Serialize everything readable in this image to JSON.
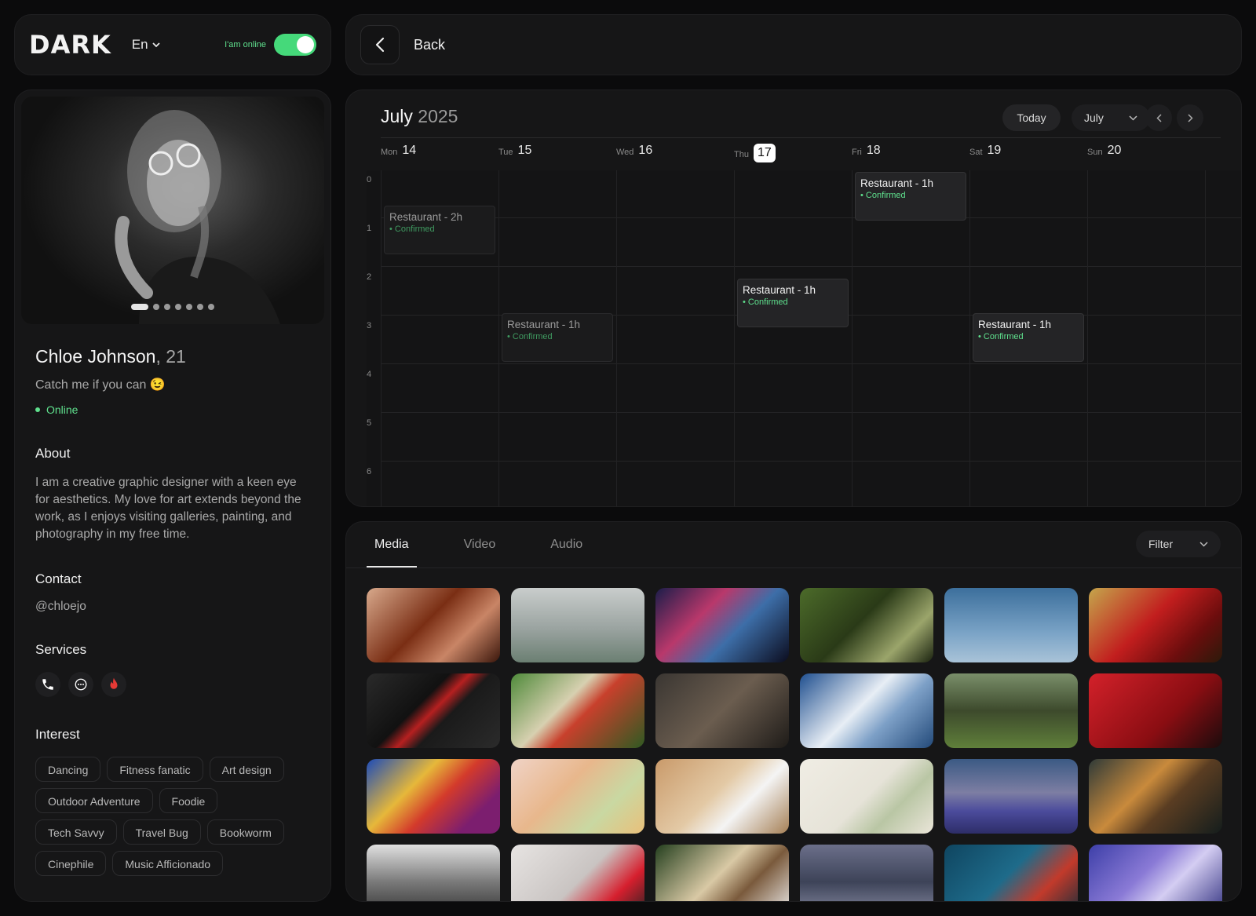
{
  "header": {
    "logo": "DARK",
    "language": "En",
    "online_label": "I'am online",
    "back_label": "Back"
  },
  "profile": {
    "carousel": {
      "count": 7,
      "active": 0
    },
    "name": "Chloe Johnson",
    "age": ", 21",
    "tagline": "Catch me if you can 😉",
    "status": "Online",
    "about_title": "About",
    "about_text": "I am a creative graphic designer with a keen eye for aesthetics. My love for art extends beyond the work, as I enjoys visiting galleries, painting, and photography in my free time.",
    "contact_title": "Contact",
    "contact": "@chloejo",
    "services_title": "Services",
    "services": [
      "phone-icon",
      "chat-icon",
      "flame-icon"
    ],
    "interest_title": "Interest",
    "interests": [
      "Dancing",
      "Fitness fanatic",
      "Art design",
      "Outdoor Adventure",
      "Foodie",
      "Tech Savvy",
      "Travel Bug",
      "Bookworm",
      "Cinephile",
      "Music Afficionado"
    ]
  },
  "calendar": {
    "month": "July",
    "year": "2025",
    "today_label": "Today",
    "month_select": "July",
    "days": [
      {
        "name": "Mon",
        "date": "14"
      },
      {
        "name": "Tue",
        "date": "15"
      },
      {
        "name": "Wed",
        "date": "16"
      },
      {
        "name": "Thu",
        "date": "17",
        "today": true
      },
      {
        "name": "Fri",
        "date": "18"
      },
      {
        "name": "Sat",
        "date": "19"
      },
      {
        "name": "Sun",
        "date": "20"
      }
    ],
    "hours": [
      "0",
      "1",
      "2",
      "3",
      "4",
      "5",
      "6"
    ],
    "events": [
      {
        "title": "Restaurant - 2h",
        "status": "Confirmed",
        "day": 0,
        "hour": 0.7,
        "faded": true
      },
      {
        "title": "Restaurant - 1h",
        "status": "Confirmed",
        "day": 1,
        "hour": 2.9,
        "faded": true
      },
      {
        "title": "Restaurant - 1h",
        "status": "Confirmed",
        "day": 3,
        "hour": 2.2,
        "faded": false
      },
      {
        "title": "Restaurant - 1h",
        "status": "Confirmed",
        "day": 4,
        "hour": 0.0,
        "faded": false
      },
      {
        "title": "Restaurant - 1h",
        "status": "Confirmed",
        "day": 5,
        "hour": 2.9,
        "faded": false
      }
    ]
  },
  "media": {
    "tabs": [
      "Media",
      "Video",
      "Audio"
    ],
    "active_tab": 0,
    "filter_label": "Filter",
    "thumbs": [
      "linear-gradient(135deg,#d8a98c,#7a2e14 45%,#c98566 70%,#3a160b)",
      "linear-gradient(180deg,#c9cdcc,#9aa3a0 55%,#6b7f72)",
      "linear-gradient(135deg,#1b1d4a,#b9386b 35%,#3d6ea8 60%,#0b0c1e)",
      "linear-gradient(135deg,#4c6b2a,#2a3a17 45%,#9ba56b 75%,#1a220f)",
      "linear-gradient(180deg,#3c6f9c,#7aa3c6 60%,#a9c3d8)",
      "linear-gradient(135deg,#c5a64c,#c21e1e 45%,#6b0d0d 75%,#2b1a0a)",
      "linear-gradient(135deg,#2a2a2a,#111 40%,#b52020 50%,#1a1a1a 60%,#2b2b2b)",
      "linear-gradient(135deg,#4f8a3a,#d7d0b0 40%,#c8402c 55%,#2f5a22)",
      "linear-gradient(135deg,#3a3632,#6b5d4f 50%,#1e1b18)",
      "linear-gradient(135deg,#1f4f8f,#e8eef5 45%,#7da0c7 65%,#234a7a)",
      "linear-gradient(180deg,#7a8f6a,#3d4a2c 50%,#5f7f3a)",
      "linear-gradient(135deg,#d3212a,#8a0d12 60%,#1a0c0c)",
      "linear-gradient(135deg,#1c4bb8,#e6b83a 35%,#d33a2b 55%,#7c1e6f 80%)",
      "linear-gradient(135deg,#f0d3c6,#e8b78c 40%,#c9d8a2 70%,#e9c07a)",
      "linear-gradient(135deg,#c99a6a,#e3c9a5 45%,#f4f4f4 65%,#a57f55)",
      "linear-gradient(135deg,#f0ede4,#e6e3d8 50%,#b9c6a4 70%,#eae5d9)",
      "linear-gradient(180deg,#3b5a84,#7d7ea3 45%,#4b4b9c 70%,#2d2d68)",
      "linear-gradient(135deg,#2f3a38,#c98a3c 40%,#5a3d22 60%,#141d1c)",
      "linear-gradient(180deg,#e0e0e0,#7a7a7a 50%,#2c2c2c)",
      "linear-gradient(135deg,#e7e4e2,#c9c4c2 50%,#d61f2e 75%,#222)",
      "linear-gradient(135deg,#243f1e,#d9c9a5 45%,#7a5a3c 65%,#f2f2f2)",
      "linear-gradient(180deg,#6b6f8a,#3d4358 50%,#8b8ea6)",
      "linear-gradient(135deg,#0f4560,#1e6b8a 45%,#c23a2b 70%,#122c3a)",
      "linear-gradient(135deg,#3d3fa8,#8a7ad6 40%,#d4cdf2 60%,#2a2a7a)"
    ]
  }
}
